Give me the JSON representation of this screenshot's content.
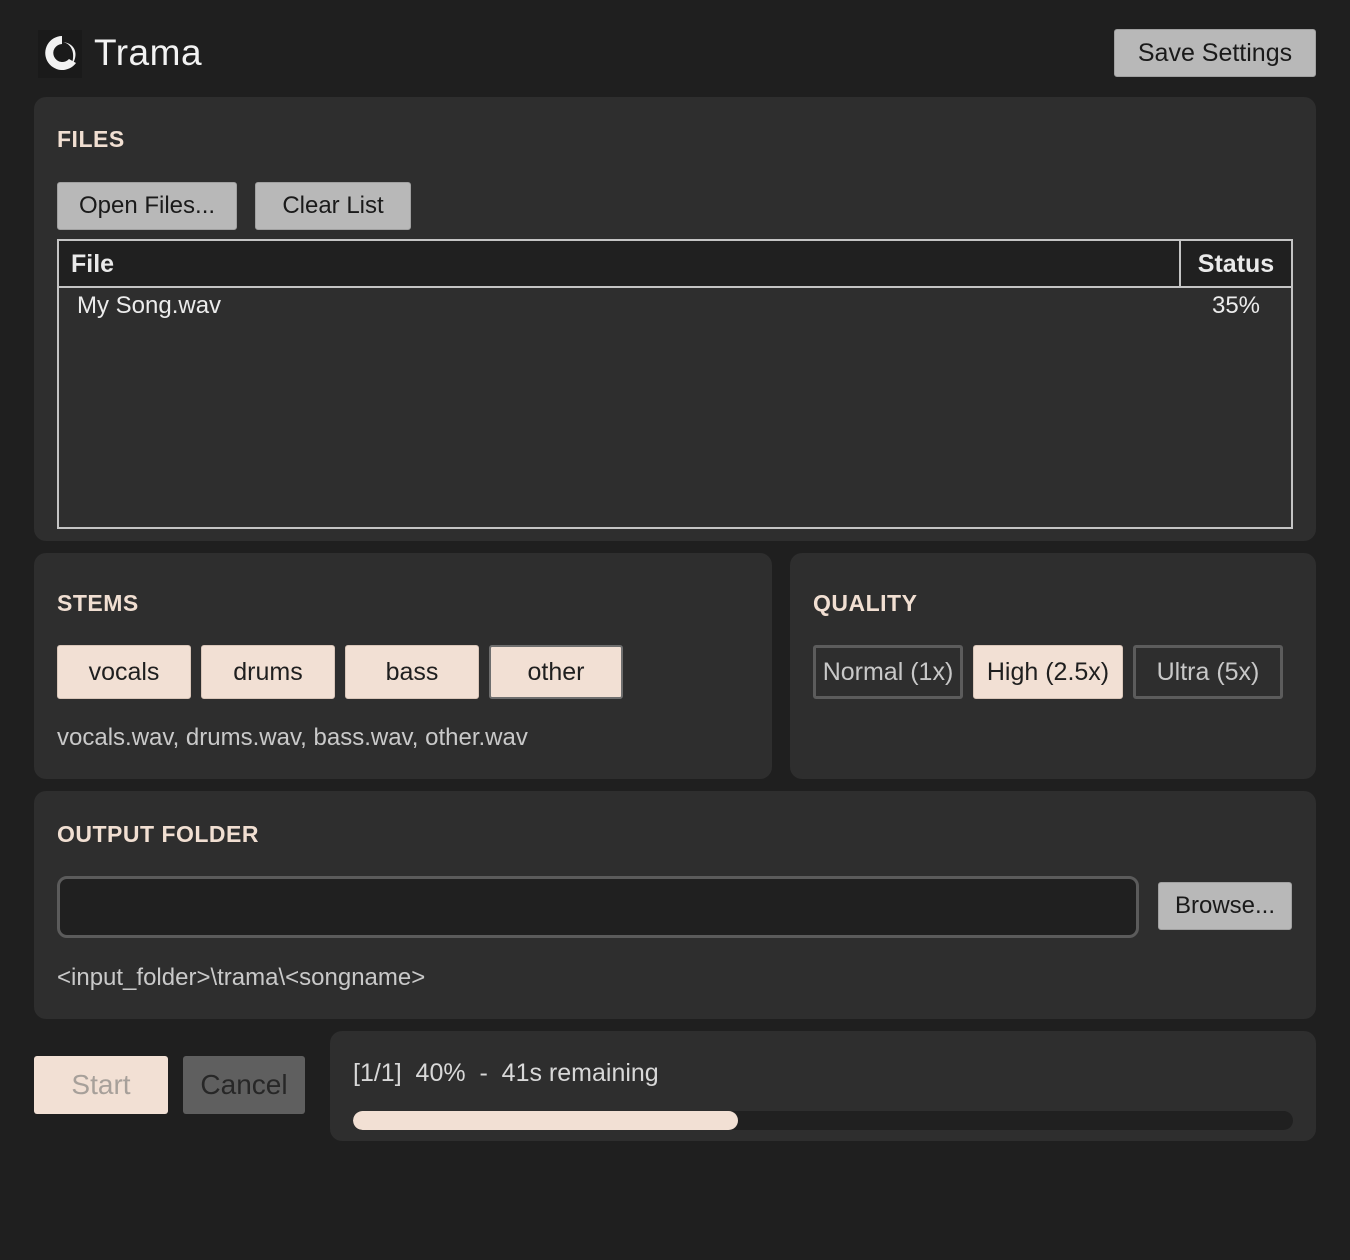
{
  "app": {
    "title": "Trama",
    "accent_color": "#f2e0d4",
    "logo_icon": "trama-logo-icon"
  },
  "header": {
    "save_label": "Save Settings"
  },
  "files": {
    "title": "FILES",
    "open_label": "Open Files...",
    "clear_label": "Clear List",
    "columns": [
      "File",
      "Status"
    ],
    "rows": [
      {
        "file": "My Song.wav",
        "status": "35%"
      }
    ]
  },
  "stems": {
    "title": "STEMS",
    "options": [
      {
        "label": "vocals",
        "selected": true
      },
      {
        "label": "drums",
        "selected": true
      },
      {
        "label": "bass",
        "selected": true
      },
      {
        "label": "other",
        "selected": true
      }
    ],
    "output_files": "vocals.wav, drums.wav, bass.wav, other.wav"
  },
  "quality": {
    "title": "QUALITY",
    "options": [
      {
        "label": "Normal (1x)",
        "selected": false
      },
      {
        "label": "High (2.5x)",
        "selected": true
      },
      {
        "label": "Ultra (5x)",
        "selected": false
      }
    ]
  },
  "output": {
    "title": "OUTPUT FOLDER",
    "value": "",
    "browse_label": "Browse...",
    "default_path": "<input_folder>\\trama\\<songname>"
  },
  "controls": {
    "start_label": "Start",
    "cancel_label": "Cancel"
  },
  "progress": {
    "text": "[1/1]  40%  -  41s remaining",
    "fraction": 0.41
  }
}
